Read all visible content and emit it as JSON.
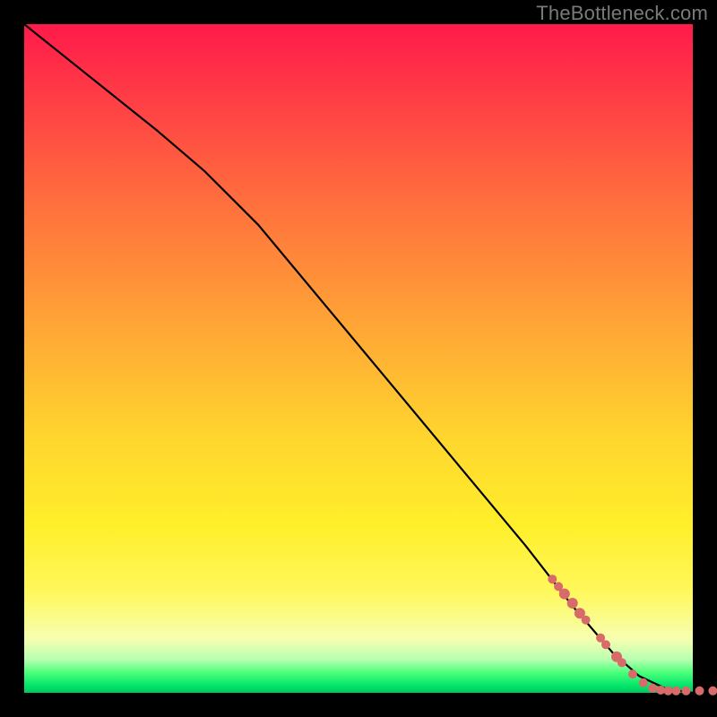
{
  "attribution": "TheBottleneck.com",
  "chart_data": {
    "type": "line",
    "title": "",
    "xlabel": "",
    "ylabel": "",
    "xlim": [
      0,
      100
    ],
    "ylim": [
      0,
      100
    ],
    "series": [
      {
        "name": "curve",
        "kind": "line",
        "x": [
          0,
          10,
          20,
          27,
          35,
          45,
          55,
          65,
          75,
          82,
          88,
          92,
          96,
          100
        ],
        "y": [
          100,
          92,
          84,
          78,
          70,
          58,
          46,
          34,
          22,
          13,
          6,
          2.5,
          0.6,
          0
        ]
      },
      {
        "name": "points",
        "kind": "scatter",
        "points": [
          {
            "x": 79.0,
            "y": 17.0,
            "r": 5
          },
          {
            "x": 79.9,
            "y": 15.9,
            "r": 5
          },
          {
            "x": 80.8,
            "y": 14.8,
            "r": 6
          },
          {
            "x": 82.0,
            "y": 13.4,
            "r": 6
          },
          {
            "x": 83.1,
            "y": 11.9,
            "r": 6
          },
          {
            "x": 84.0,
            "y": 10.9,
            "r": 5
          },
          {
            "x": 86.2,
            "y": 8.2,
            "r": 5
          },
          {
            "x": 87.0,
            "y": 7.2,
            "r": 5
          },
          {
            "x": 88.6,
            "y": 5.4,
            "r": 6
          },
          {
            "x": 89.4,
            "y": 4.5,
            "r": 5
          },
          {
            "x": 91.0,
            "y": 2.8,
            "r": 5
          },
          {
            "x": 92.6,
            "y": 1.5,
            "r": 5
          },
          {
            "x": 94.0,
            "y": 0.7,
            "r": 5
          },
          {
            "x": 95.2,
            "y": 0.4,
            "r": 5
          },
          {
            "x": 96.3,
            "y": 0.3,
            "r": 5
          },
          {
            "x": 97.5,
            "y": 0.3,
            "r": 5
          },
          {
            "x": 99.0,
            "y": 0.3,
            "r": 5
          },
          {
            "x": 101.0,
            "y": 0.3,
            "r": 5
          },
          {
            "x": 103.0,
            "y": 0.3,
            "r": 5
          }
        ]
      }
    ],
    "gradient_note": "Background is a vertical spectral gradient from red (top) through orange/yellow to green (bottom), inside a black border."
  }
}
